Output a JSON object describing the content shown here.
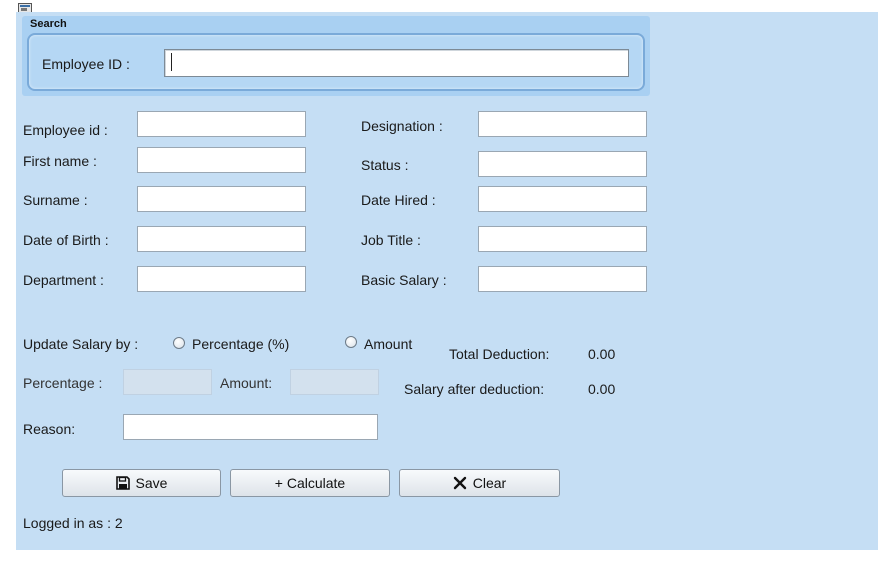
{
  "window": {
    "icon": "app-window-icon"
  },
  "search": {
    "title": "Search",
    "employee_id_label": "Employee ID :",
    "employee_id_value": ""
  },
  "form": {
    "left": [
      {
        "label": "Employee id :",
        "value": ""
      },
      {
        "label": "First name :",
        "value": ""
      },
      {
        "label": "Surname :",
        "value": ""
      },
      {
        "label": "Date of Birth :",
        "value": ""
      },
      {
        "label": "Department :",
        "value": ""
      }
    ],
    "right": [
      {
        "label": "Designation :",
        "value": ""
      },
      {
        "label": "Status :",
        "value": ""
      },
      {
        "label": "Date Hired :",
        "value": ""
      },
      {
        "label": "Job Title :",
        "value": ""
      },
      {
        "label": "Basic Salary :",
        "value": ""
      }
    ]
  },
  "salary_update": {
    "label": "Update Salary by :",
    "option_percentage": "Percentage (%)",
    "option_amount": "Amount",
    "percentage_label": "Percentage :",
    "amount_label": "Amount:",
    "total_deduction_label": "Total Deduction:",
    "total_deduction_value": "0.00",
    "salary_after_label": "Salary after deduction:",
    "salary_after_value": "0.00",
    "reason_label": "Reason:",
    "reason_value": ""
  },
  "buttons": {
    "save": {
      "label": "Save",
      "icon": "save-icon"
    },
    "calculate": {
      "label": "+ Calculate"
    },
    "clear": {
      "label": "Clear",
      "icon": "clear-icon"
    }
  },
  "status": {
    "logged_in": "Logged in as : 2"
  }
}
